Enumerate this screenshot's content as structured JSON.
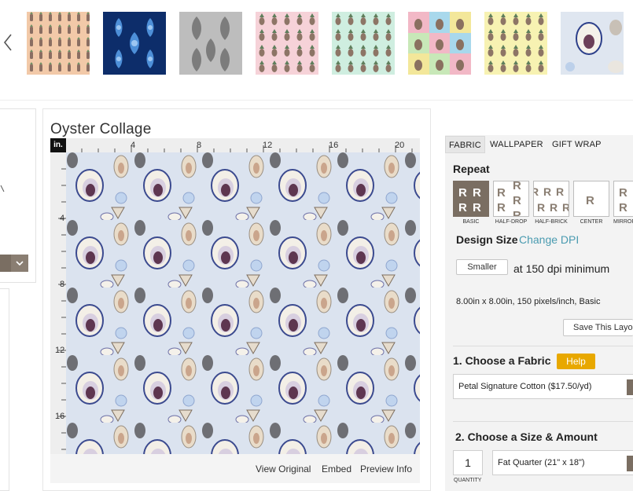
{
  "design": {
    "title": "Oyster Collage"
  },
  "ruler": {
    "unit": "in.",
    "top_labels": [
      "4",
      "8",
      "12",
      "16",
      "20"
    ],
    "left_labels": [
      "4",
      "8",
      "12",
      "16"
    ]
  },
  "preview_links": {
    "view_original": "View Original",
    "embed": "Embed",
    "preview_info": "Preview Info"
  },
  "product_tabs": [
    "FABRIC",
    "WALLPAPER",
    "GIFT WRAP"
  ],
  "repeat": {
    "heading": "Repeat",
    "options": [
      {
        "label": "BASIC",
        "selected": true
      },
      {
        "label": "HALF-DROP",
        "selected": false
      },
      {
        "label": "HALF-BRICK",
        "selected": false
      },
      {
        "label": "CENTER",
        "selected": false
      },
      {
        "label": "MIRROR",
        "selected": false
      }
    ]
  },
  "design_size": {
    "heading": "Design Size",
    "change_dpi": "Change DPI",
    "smaller_button": "Smaller",
    "dpi_text": "at 150 dpi minimum",
    "info": "8.00in x 8.00in, 150 pixels/inch, Basic",
    "save_layout": "Save This Layout"
  },
  "fabric": {
    "heading": "1. Choose a Fabric",
    "help": "Help",
    "selected": "Petal Signature Cotton ($17.50/yd)"
  },
  "size_amount": {
    "heading": "2. Choose a Size & Amount",
    "quantity": "1",
    "quantity_label": "QUANTITY",
    "size": "Fat Quarter (21\" x 18\")"
  },
  "colors": {
    "accent": "#4a9bb0",
    "help_bg": "#e8a800",
    "selected_repeat": "#7a6e62"
  }
}
